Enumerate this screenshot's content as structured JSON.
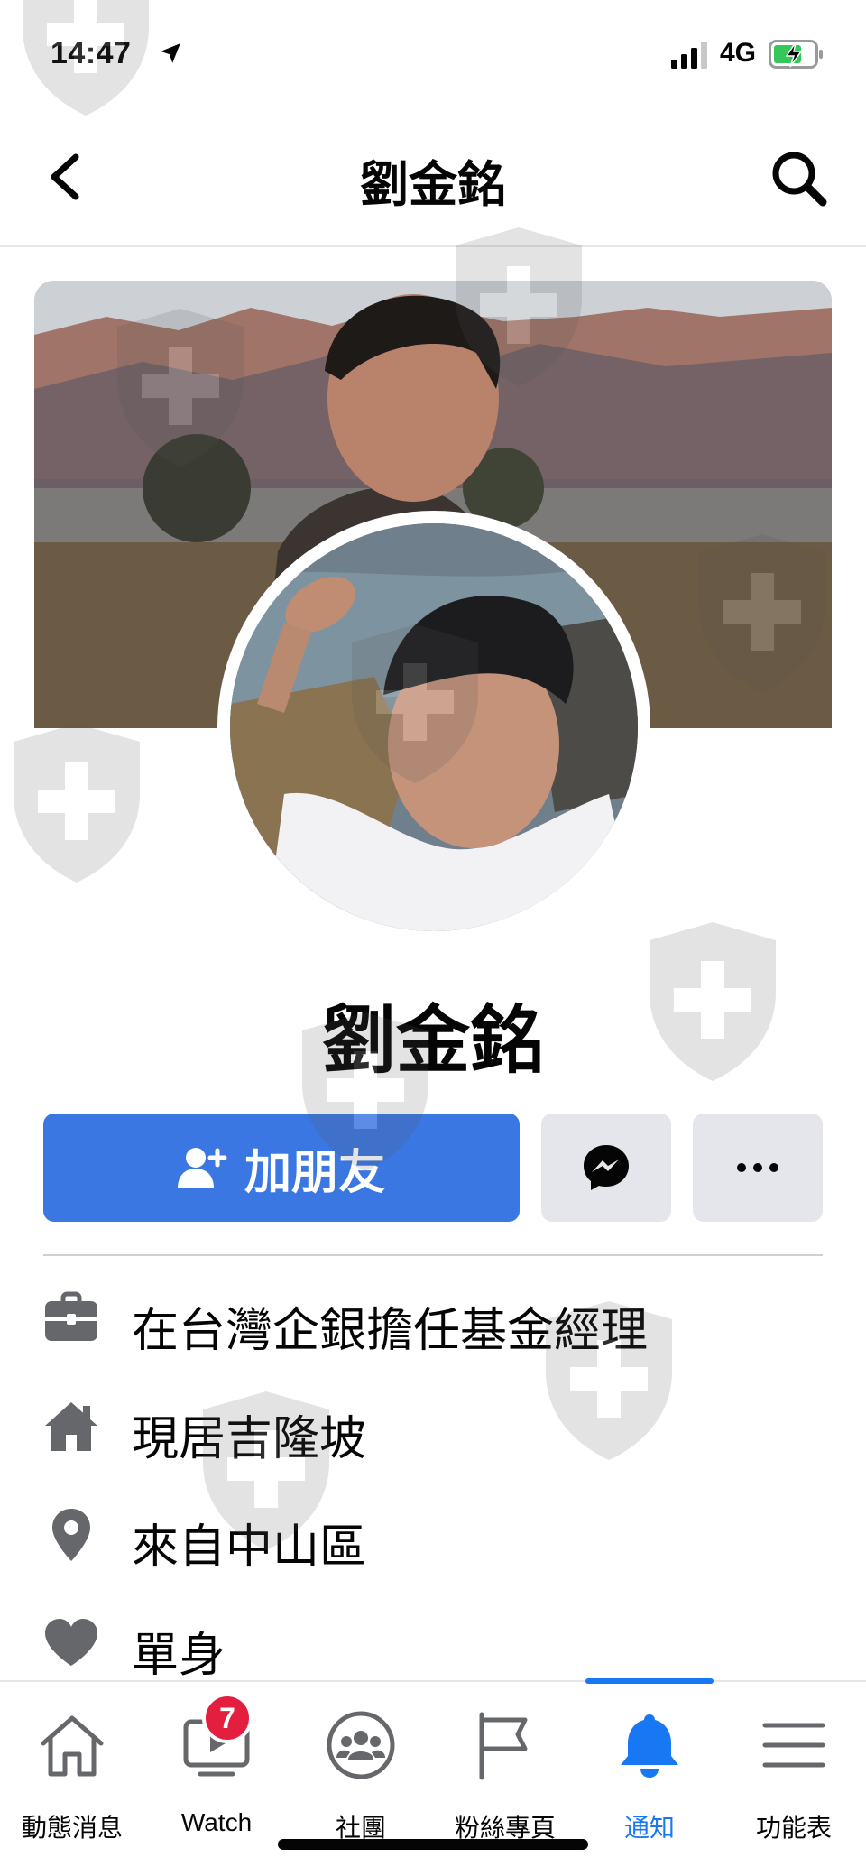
{
  "status_bar": {
    "time": "14:47",
    "network": "4G"
  },
  "header": {
    "title": "劉金銘"
  },
  "profile": {
    "name": "劉金銘"
  },
  "actions": {
    "add_friend_label": "加朋友"
  },
  "details": [
    {
      "icon": "briefcase-icon",
      "text": "在台灣企銀擔任基金經理"
    },
    {
      "icon": "home-icon",
      "text": "現居吉隆坡"
    },
    {
      "icon": "location-pin-icon",
      "text": "來自中山區"
    },
    {
      "icon": "heart-icon",
      "text": "單身"
    }
  ],
  "bottom_nav": {
    "items": [
      {
        "label": "動態消息",
        "icon": "home-icon"
      },
      {
        "label": "Watch",
        "icon": "watch-icon",
        "badge": "7"
      },
      {
        "label": "社團",
        "icon": "groups-icon"
      },
      {
        "label": "粉絲專頁",
        "icon": "flag-icon"
      },
      {
        "label": "通知",
        "icon": "bell-icon",
        "active": true
      },
      {
        "label": "功能表",
        "icon": "menu-icon"
      }
    ]
  },
  "colors": {
    "accent": "#1877f2",
    "button_blue": "#3b77e3",
    "button_gray": "#e4e6eb",
    "badge_red": "#e41e3f"
  }
}
